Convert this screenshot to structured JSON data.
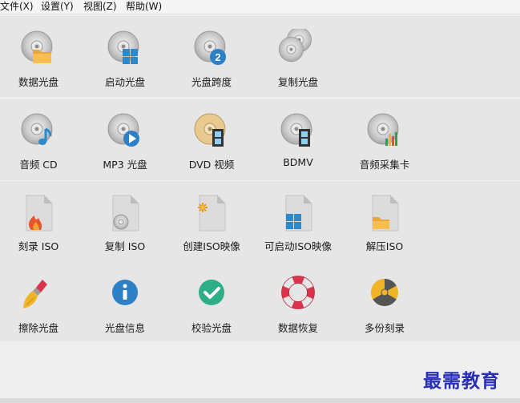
{
  "menu": [
    {
      "label": "文件(X)"
    },
    {
      "label": "设置(Y)"
    },
    {
      "label": "视图(Z)"
    },
    {
      "label": "帮助(W)"
    }
  ],
  "rows": [
    [
      {
        "label": "数据光盘",
        "icon": "data-disc-icon"
      },
      {
        "label": "启动光盘",
        "icon": "boot-disc-icon"
      },
      {
        "label": "光盘跨度",
        "icon": "disc-span-icon"
      },
      {
        "label": "复制光盘",
        "icon": "copy-disc-icon"
      }
    ],
    [
      {
        "label": "音频 CD",
        "icon": "audio-cd-icon"
      },
      {
        "label": "MP3 光盘",
        "icon": "mp3-disc-icon"
      },
      {
        "label": "DVD 视频",
        "icon": "dvd-video-icon"
      },
      {
        "label": "BDMV",
        "icon": "bdmv-icon"
      },
      {
        "label": "音频采集卡",
        "icon": "audio-capture-icon"
      }
    ],
    [
      {
        "label": "刻录 ISO",
        "icon": "burn-iso-icon"
      },
      {
        "label": "复制 ISO",
        "icon": "copy-iso-icon"
      },
      {
        "label": "创建ISO映像",
        "icon": "create-iso-icon"
      },
      {
        "label": "可启动ISO映像",
        "icon": "bootable-iso-icon"
      },
      {
        "label": "解压ISO",
        "icon": "extract-iso-icon"
      }
    ],
    [
      {
        "label": "擦除光盘",
        "icon": "erase-disc-icon"
      },
      {
        "label": "光盘信息",
        "icon": "disc-info-icon"
      },
      {
        "label": "校验光盘",
        "icon": "verify-disc-icon"
      },
      {
        "label": "数据恢复",
        "icon": "data-recovery-icon"
      },
      {
        "label": "多份刻录",
        "icon": "multi-burn-icon"
      }
    ]
  ],
  "watermark": "最需教育",
  "colors": {
    "accent": "#2a7fc9",
    "band": "#e6e6e6",
    "watermark": "#2a2fb8"
  }
}
